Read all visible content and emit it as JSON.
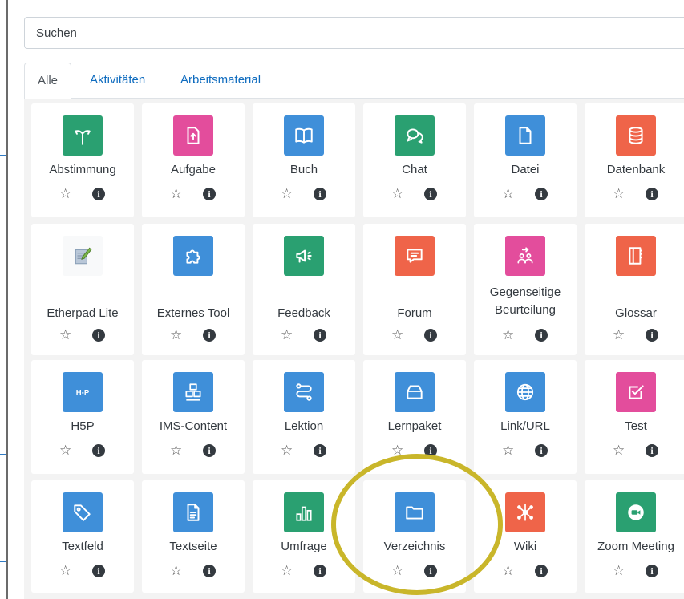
{
  "search": {
    "placeholder": "Suchen"
  },
  "tabs": [
    {
      "label": "Alle",
      "active": true
    },
    {
      "label": "Aktivitäten",
      "active": false
    },
    {
      "label": "Arbeitsmaterial",
      "active": false
    }
  ],
  "colors": {
    "green": "#2aa071",
    "pink": "#e34d9c",
    "blue": "#3f8fd9",
    "red": "#ef6449",
    "highlight": "#c9b62a"
  },
  "modules": [
    {
      "name": "Abstimmung",
      "icon": "signpost-icon",
      "color": "#2aa071"
    },
    {
      "name": "Aufgabe",
      "icon": "file-upload-icon",
      "color": "#e34d9c"
    },
    {
      "name": "Buch",
      "icon": "book-icon",
      "color": "#3f8fd9"
    },
    {
      "name": "Chat",
      "icon": "chat-bubbles-icon",
      "color": "#2aa071"
    },
    {
      "name": "Datei",
      "icon": "file-icon",
      "color": "#3f8fd9"
    },
    {
      "name": "Datenbank",
      "icon": "database-icon",
      "color": "#ef6449"
    },
    {
      "name": "Etherpad Lite",
      "icon": "etherpad-icon",
      "color": "#f8f9fa"
    },
    {
      "name": "Externes Tool",
      "icon": "puzzle-icon",
      "color": "#3f8fd9"
    },
    {
      "name": "Feedback",
      "icon": "megaphone-icon",
      "color": "#2aa071"
    },
    {
      "name": "Forum",
      "icon": "forum-icon",
      "color": "#ef6449"
    },
    {
      "name": "Gegenseitige Beurteilung",
      "icon": "workshop-icon",
      "color": "#e34d9c"
    },
    {
      "name": "Glossar",
      "icon": "glossary-icon",
      "color": "#ef6449"
    },
    {
      "name": "H5P",
      "icon": "h5p-icon",
      "color": "#3f8fd9"
    },
    {
      "name": "IMS-Content",
      "icon": "boxes-icon",
      "color": "#3f8fd9"
    },
    {
      "name": "Lektion",
      "icon": "path-icon",
      "color": "#3f8fd9"
    },
    {
      "name": "Lernpaket",
      "icon": "package-icon",
      "color": "#3f8fd9"
    },
    {
      "name": "Link/URL",
      "icon": "globe-icon",
      "color": "#3f8fd9"
    },
    {
      "name": "Test",
      "icon": "checkbox-icon",
      "color": "#e34d9c"
    },
    {
      "name": "Textfeld",
      "icon": "tag-icon",
      "color": "#3f8fd9"
    },
    {
      "name": "Textseite",
      "icon": "document-icon",
      "color": "#3f8fd9"
    },
    {
      "name": "Umfrage",
      "icon": "bar-chart-icon",
      "color": "#2aa071"
    },
    {
      "name": "Verzeichnis",
      "icon": "folder-icon",
      "color": "#3f8fd9"
    },
    {
      "name": "Wiki",
      "icon": "wiki-network-icon",
      "color": "#ef6449"
    },
    {
      "name": "Zoom Meeting",
      "icon": "zoom-camera-icon",
      "color": "#2aa071"
    }
  ],
  "star_glyph": "☆",
  "info_glyph": "i"
}
